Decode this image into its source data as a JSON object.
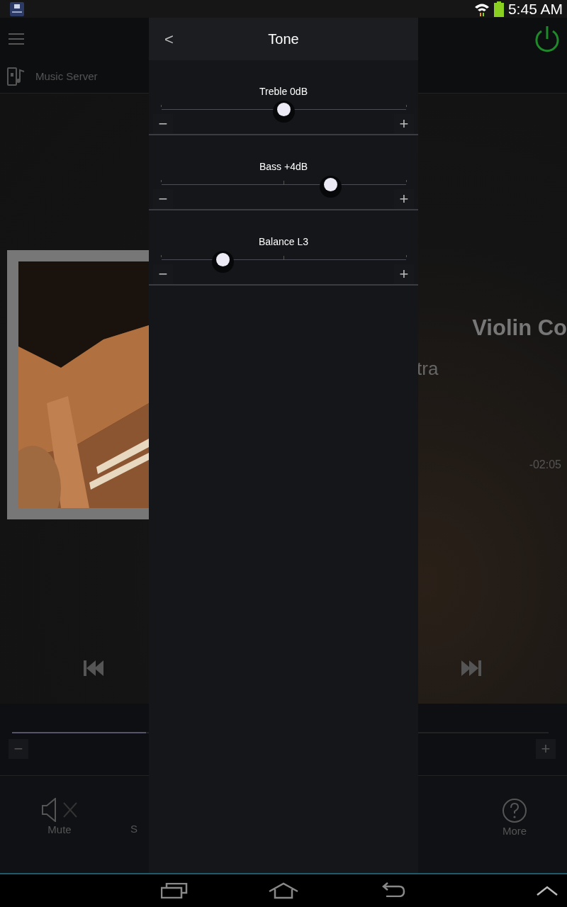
{
  "status_bar": {
    "time": "5:45 AM"
  },
  "source": {
    "label": "Music Server"
  },
  "now_playing": {
    "title": "Violin Co",
    "artist": "tra",
    "remaining": "-02:05"
  },
  "bottom_bar": [
    {
      "kind": "mute",
      "label": "Mute"
    },
    {
      "kind": "partial",
      "label": "S"
    },
    {
      "kind": "more",
      "label": "More"
    }
  ],
  "tone_panel": {
    "title": "Tone",
    "back": "<",
    "controls": [
      {
        "label": "Treble 0dB",
        "level": 0.5,
        "minus": "−",
        "plus": "+"
      },
      {
        "label": "Bass +4dB",
        "level": 0.69,
        "minus": "−",
        "plus": "+"
      },
      {
        "label": "Balance L3",
        "level": 0.25,
        "minus": "−",
        "plus": "+"
      }
    ]
  },
  "volume": {
    "level": 0.25,
    "minus": "−",
    "plus": "+"
  }
}
